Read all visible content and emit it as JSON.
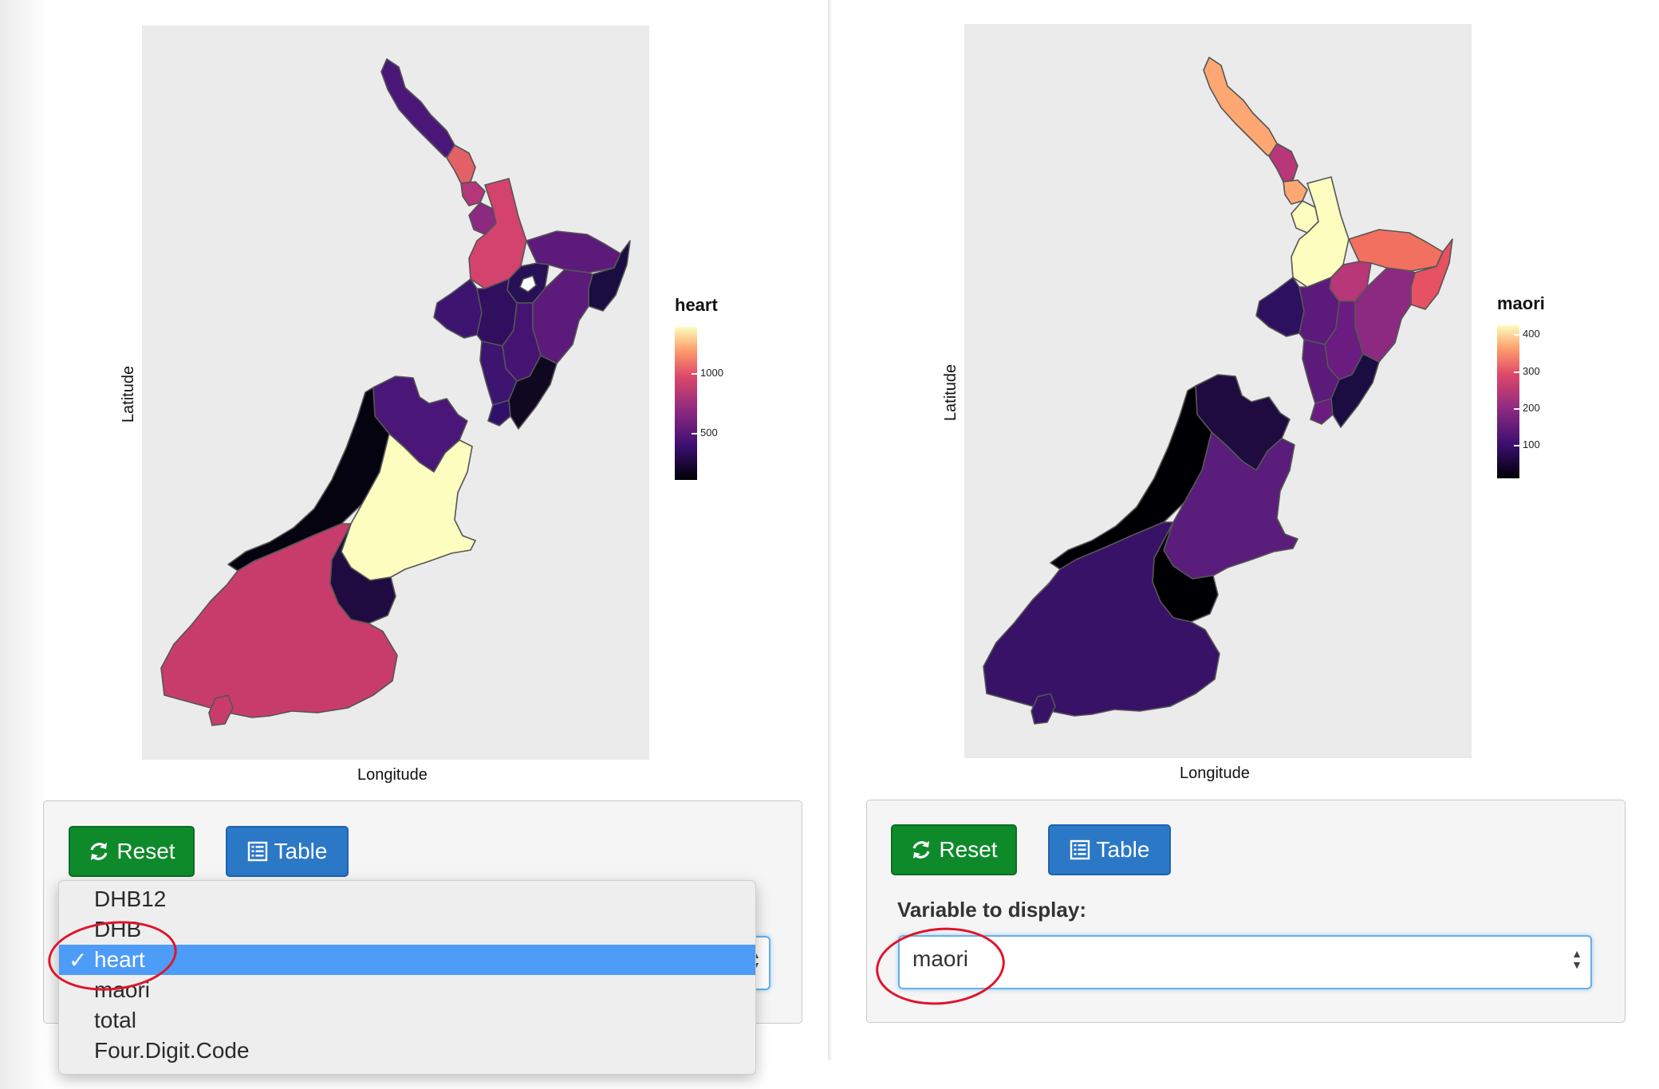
{
  "left_panel": {
    "axis_y": "Latitude",
    "axis_x": "Longitude",
    "legend": {
      "title": "heart",
      "ticks": [
        "1000",
        "500"
      ]
    },
    "buttons": {
      "reset": "Reset",
      "table": "Table"
    },
    "dropdown": {
      "options": [
        "DHB12",
        "DHB",
        "heart",
        "maori",
        "total",
        "Four.Digit.Code"
      ],
      "selected": "heart",
      "checkmark": "✓"
    }
  },
  "right_panel": {
    "axis_y": "Latitude",
    "axis_x": "Longitude",
    "legend": {
      "title": "maori",
      "ticks": [
        "400",
        "300",
        "200",
        "100"
      ]
    },
    "buttons": {
      "reset": "Reset",
      "table": "Table"
    },
    "variable_label": "Variable to display:",
    "select_value": "maori"
  },
  "icons": [
    "refresh-icon",
    "table-list-icon",
    "select-arrows-icon"
  ],
  "colors": {
    "reset_button": "#0e8a2b",
    "table_button": "#2b78c7",
    "selected_option": "#4d9cf8",
    "annotation_ring": "#e0142b",
    "plot_background": "#ebebeb"
  },
  "scales": {
    "heart": {
      "palette": "magma",
      "approx_range": [
        150,
        1400
      ]
    },
    "maori": {
      "palette": "magma",
      "approx_range": [
        20,
        430
      ]
    }
  }
}
